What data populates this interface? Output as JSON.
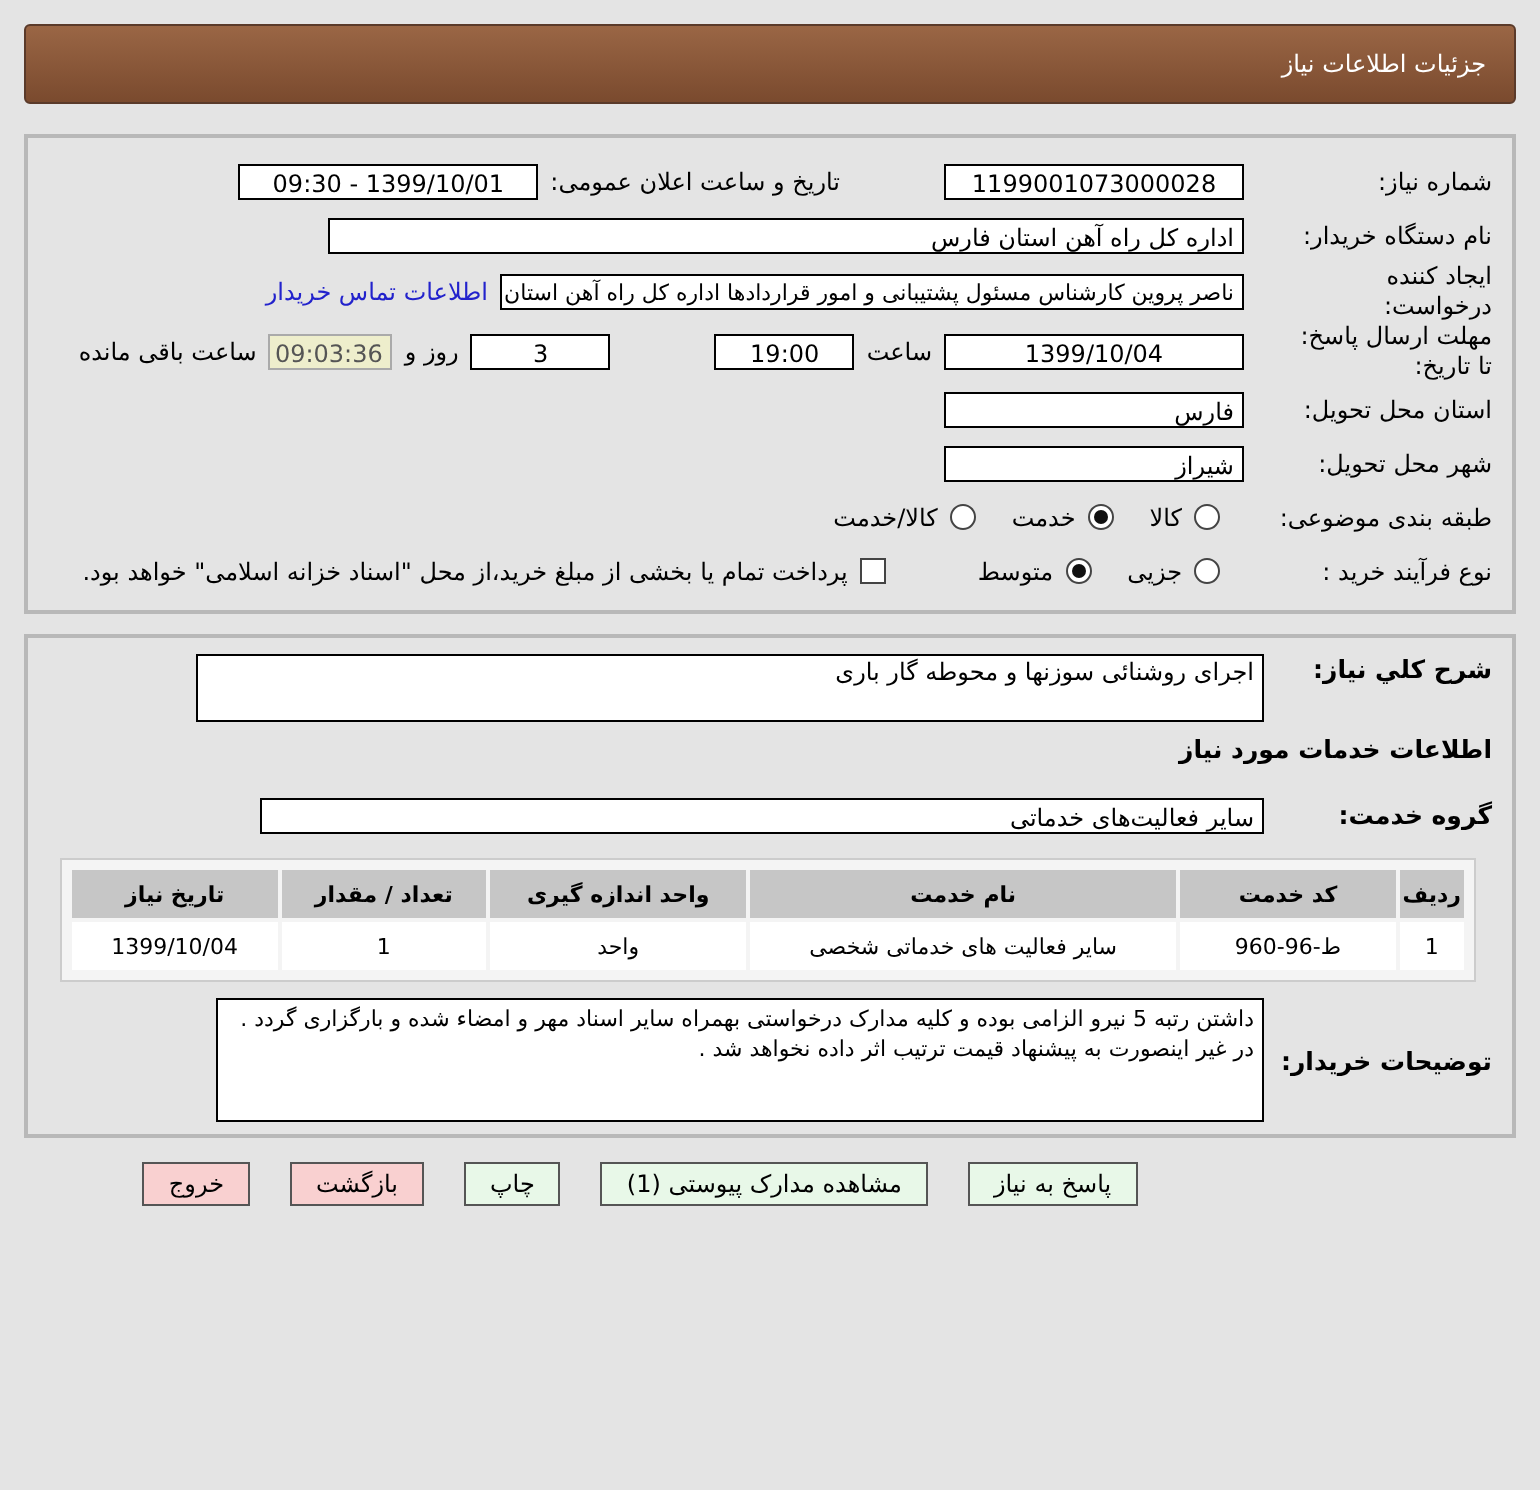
{
  "header": {
    "title": "جزئیات اطلاعات نیاز"
  },
  "details": {
    "need_number": {
      "label": "شماره نیاز:",
      "value": "1199001073000028"
    },
    "announce": {
      "label": "تاریخ و ساعت اعلان عمومی:",
      "value": "1399/10/01 - 09:30"
    },
    "buyer_org": {
      "label": "نام دستگاه خریدار:",
      "value": "اداره کل راه آهن استان فارس"
    },
    "requester": {
      "label": [
        "ایجاد کننده",
        "درخواست:"
      ],
      "value": "ناصر پروین کارشناس مسئول پشتیبانی و امور قراردادها اداره کل راه آهن استان",
      "link": "اطلاعات تماس خریدار"
    },
    "deadline": {
      "label": [
        "مهلت ارسال پاسخ:",
        "تا تاریخ:"
      ],
      "date": "1399/10/04",
      "time_label": "ساعت",
      "time": "19:00",
      "days": "3",
      "days_label": "روز و",
      "remaining": "09:03:36",
      "remaining_label": "ساعت باقی مانده"
    },
    "province": {
      "label": "استان محل تحویل:",
      "value": "فارس"
    },
    "city": {
      "label": "شهر محل تحویل:",
      "value": "شیراز"
    },
    "category": {
      "label": "طبقه بندی موضوعی:",
      "options": [
        {
          "label": "کالا",
          "selected": false
        },
        {
          "label": "خدمت",
          "selected": true
        },
        {
          "label": "کالا/خدمت",
          "selected": false
        }
      ]
    },
    "process": {
      "label": "نوع فرآیند خرید :",
      "options": [
        {
          "label": "جزیی",
          "selected": false
        },
        {
          "label": "متوسط",
          "selected": true
        }
      ],
      "payment": {
        "checked": false,
        "text": "پرداخت تمام یا بخشی از مبلغ خرید،از محل \"اسناد خزانه اسلامی\" خواهد بود."
      }
    }
  },
  "need": {
    "description": {
      "label": "شرح کلي نياز:",
      "value": "اجرای روشنائی سوزنها و محوطه گار باری"
    },
    "services_title": "اطلاعات خدمات مورد نياز",
    "service_group": {
      "label": "گروه خدمت:",
      "value": "سایر فعالیت‌های خدماتی"
    },
    "table": {
      "columns": [
        "ردیف",
        "کد خدمت",
        "نام خدمت",
        "واحد اندازه گیری",
        "تعداد / مقدار",
        "تاریخ نیاز"
      ],
      "rows": [
        [
          "1",
          "ط-96-960",
          "سایر فعالیت های خدماتی شخصی",
          "واحد",
          "1",
          "1399/10/04"
        ]
      ]
    },
    "buyer_notes": {
      "label": "توضیحات خریدار:",
      "value": "داشتن رتبه 5 نیرو الزامی بوده و کلیه مدارک درخواستی بهمراه سایر اسناد مهر و امضاء شده و بارگزاری گردد . در غیر اینصورت به پیشنهاد قیمت ترتیب اثر داده نخواهد شد ."
    }
  },
  "buttons": [
    {
      "label": "پاسخ به نیاز",
      "kind": "action"
    },
    {
      "label": "مشاهده مدارک پیوستی (1)",
      "kind": "action"
    },
    {
      "label": "چاپ",
      "kind": "action"
    },
    {
      "label": "بازگشت",
      "kind": "exit"
    },
    {
      "label": "خروج",
      "kind": "exit"
    }
  ]
}
